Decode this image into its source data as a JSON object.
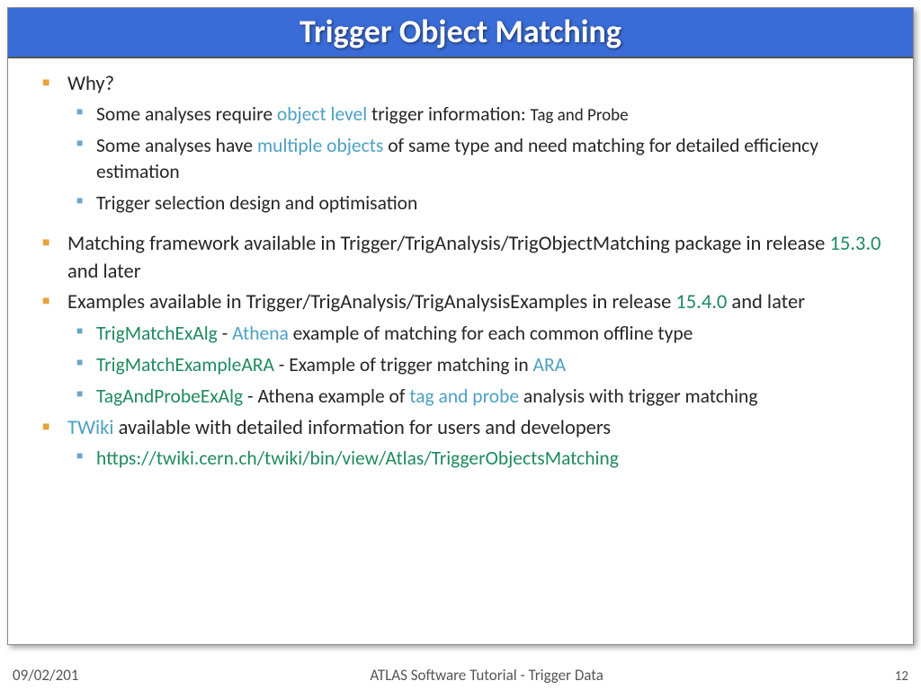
{
  "title": "Trigger Object Matching",
  "bullets": {
    "why_heading": "Why?",
    "why_sub1_pre": "Some analyses require ",
    "why_sub1_em": "object level",
    "why_sub1_post": " trigger information: ",
    "why_sub1_tail": "Tag and Probe",
    "why_sub2_pre": "Some analyses have ",
    "why_sub2_em": "multiple objects",
    "why_sub2_post": " of same type and need matching for detailed efficiency estimation",
    "why_sub3": "Trigger selection design and optimisation",
    "frame_pre": "Matching framework available in Trigger/TrigAnalysis/TrigObjectMatching package in release ",
    "frame_ver": "15.3.0",
    "frame_post": " and later",
    "ex_pre": "Examples available in Trigger/TrigAnalysis/TrigAnalysisExamples in release ",
    "ex_ver": "15.4.0",
    "ex_post": " and later",
    "ex1_alg": "TrigMatchExAlg",
    "ex1_sep": " - ",
    "ex1_athena": "Athena",
    "ex1_post": " example of matching for each common offline type",
    "ex2_alg": "TrigMatchExampleARA",
    "ex2_mid": " - Example of trigger matching in ",
    "ex2_ara": "ARA",
    "ex3_alg": "TagAndProbeExAlg",
    "ex3_mid": " - Athena example of ",
    "ex3_tp": "tag and probe",
    "ex3_post": " analysis with trigger matching",
    "twiki_link": "TWiki",
    "twiki_post": " available with detailed information for users and developers",
    "twiki_url": "https://twiki.cern.ch/twiki/bin/view/Atlas/TriggerObjectsMatching"
  },
  "footer": {
    "date": "09/02/201",
    "center": "ATLAS Software Tutorial - Trigger Data",
    "page": "12"
  }
}
